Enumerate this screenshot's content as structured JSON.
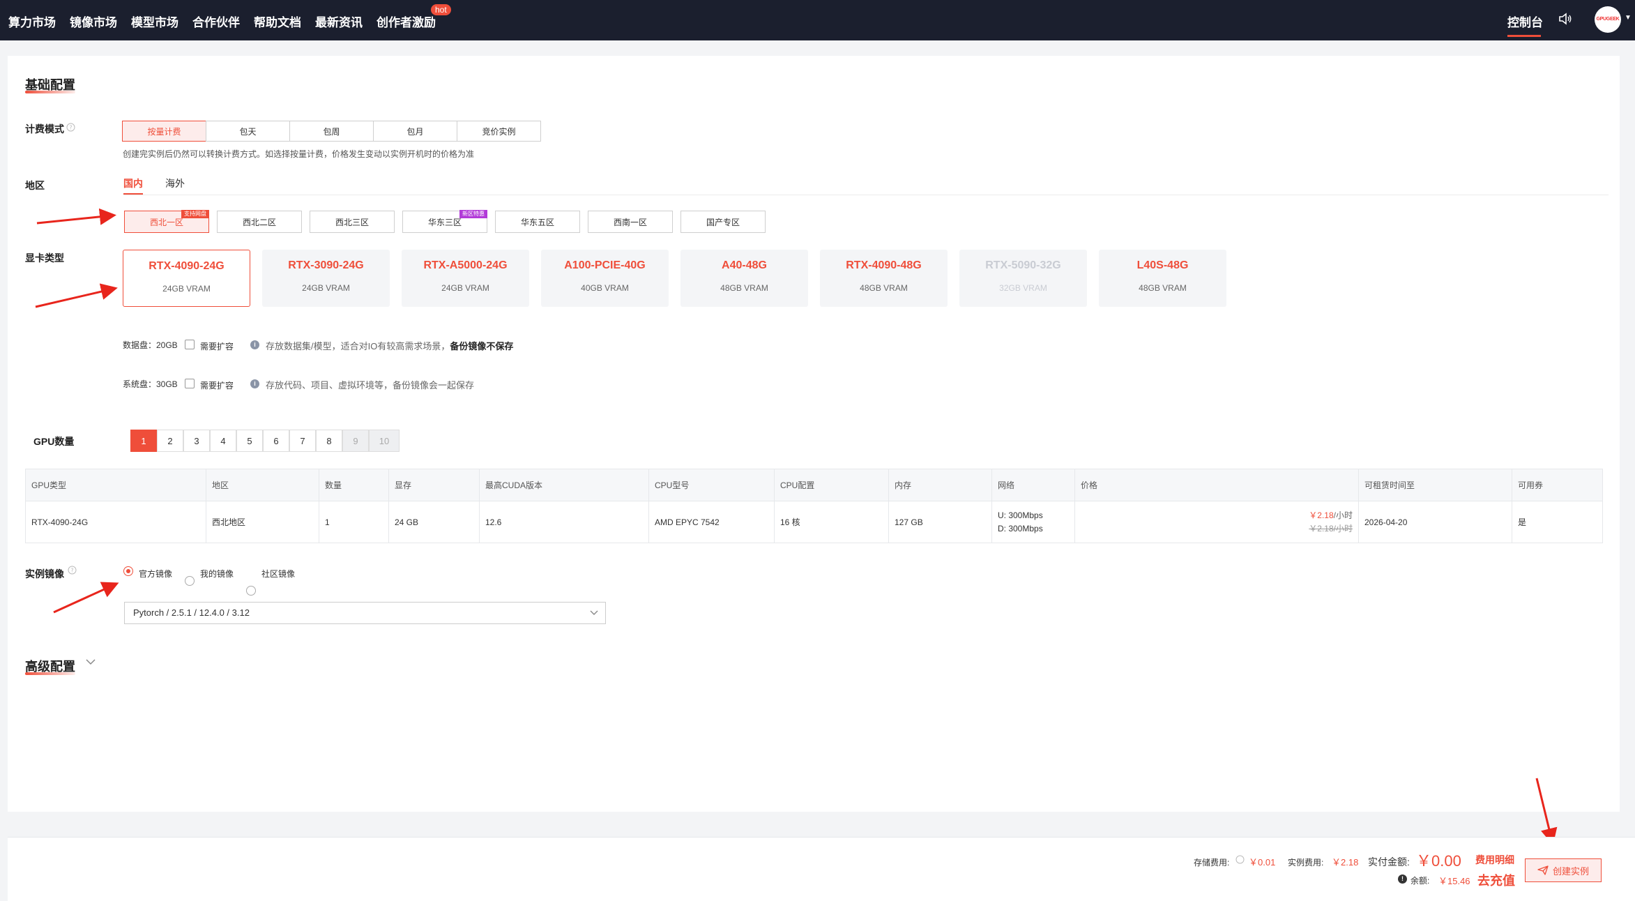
{
  "nav": {
    "items": [
      "算力市场",
      "镜像市场",
      "模型市场",
      "合作伙伴",
      "帮助文档",
      "最新资讯",
      "创作者激励"
    ],
    "hot_badge": "hot",
    "console": "控制台",
    "avatar_text": "GPUGEEK"
  },
  "basic": {
    "title": "基础配置",
    "billing_label": "计费模式",
    "billing_options": [
      "按量计费",
      "包天",
      "包周",
      "包月",
      "竞价实例"
    ],
    "billing_selected": "按量计费",
    "billing_hint": "创建完实例后仍然可以转换计费方式。如选择按量计费，价格发生变动以实例开机时的价格为准",
    "region_label": "地区",
    "region_tabs": [
      "国内",
      "海外"
    ],
    "regions": [
      "西北一区",
      "西北二区",
      "西北三区",
      "华东三区",
      "华东五区",
      "西南一区",
      "国产专区"
    ],
    "region_selected": "西北一区",
    "region_tags": {
      "westnorth1": "支持网盘",
      "eastchina3": "新区特惠"
    },
    "gpu_label": "显卡类型",
    "gpus": [
      {
        "name": "RTX-4090-24G",
        "vram": "24GB VRAM"
      },
      {
        "name": "RTX-3090-24G",
        "vram": "24GB VRAM"
      },
      {
        "name": "RTX-A5000-24G",
        "vram": "24GB VRAM"
      },
      {
        "name": "A100-PCIE-40G",
        "vram": "40GB VRAM"
      },
      {
        "name": "A40-48G",
        "vram": "48GB VRAM"
      },
      {
        "name": "RTX-4090-48G",
        "vram": "48GB VRAM"
      },
      {
        "name": "RTX-5090-32G",
        "vram": "32GB VRAM"
      },
      {
        "name": "L40S-48G",
        "vram": "48GB VRAM"
      }
    ],
    "gpu_selected": "RTX-4090-24G",
    "gpu_disabled": "RTX-5090-32G",
    "data_disk": {
      "label": "数据盘：20GB",
      "expand": "需要扩容",
      "hint": "存放数据集/模型，适合对IO有较高需求场景，",
      "hint_bold": "备份镜像不保存"
    },
    "sys_disk": {
      "label": "系统盘：30GB",
      "expand": "需要扩容",
      "hint": "存放代码、项目、虚拟环境等，备份镜像会一起保存"
    },
    "gpu_count_label": "GPU数量",
    "gpu_counts": [
      "1",
      "2",
      "3",
      "4",
      "5",
      "6",
      "7",
      "8",
      "9",
      "10"
    ],
    "gpu_count_selected": "1"
  },
  "table": {
    "headers": [
      "GPU类型",
      "地区",
      "数量",
      "显存",
      "最高CUDA版本",
      "CPU型号",
      "CPU配置",
      "内存",
      "网络",
      "价格",
      "可租赁时间至",
      "可用券"
    ],
    "row": {
      "gpu": "RTX-4090-24G",
      "region": "西北地区",
      "count": "1",
      "vram": "24 GB",
      "cuda": "12.6",
      "cpu_model": "AMD EPYC 7542",
      "cpu_cfg": "16 核",
      "mem": "127 GB",
      "net_up": "U: 300Mbps",
      "net_down": "D: 300Mbps",
      "price_now": "￥2.18",
      "price_unit": "/小时",
      "price_old": "￥2.18/小时",
      "until": "2026-04-20",
      "coupon": "是"
    }
  },
  "image": {
    "label": "实例镜像",
    "options": [
      "官方镜像",
      "我的镜像",
      "社区镜像"
    ],
    "selected": "官方镜像",
    "value": "Pytorch / 2.5.1 / 12.4.0 / 3.12"
  },
  "advanced": {
    "title": "高级配置"
  },
  "footer": {
    "storage_label": "存储费用:",
    "storage_val": "￥0.01",
    "instance_label": "实例费用:",
    "instance_val": "￥2.18",
    "paid_label": "实付金额:",
    "paid_val": "￥0.00",
    "detail_link": "费用明细",
    "balance_label": "余额:",
    "balance_val": "￥15.46",
    "recharge": "去充值",
    "create": "创建实例"
  },
  "colors": {
    "accent": "#ef4e3a",
    "nav_bg": "#1b1f2e"
  }
}
